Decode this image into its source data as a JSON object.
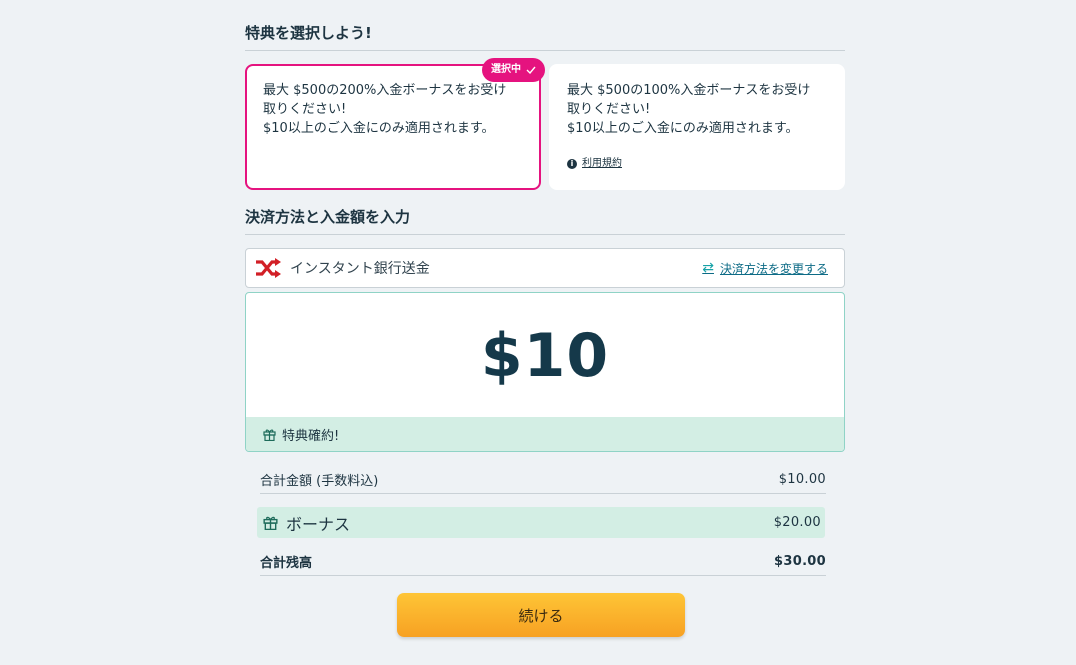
{
  "bonus_section": {
    "title": "特典を選択しよう!",
    "cards": [
      {
        "text": "最大 $500の200%入金ボーナスをお受け\n取りください!\n$10以上のご入金にのみ適用されます。",
        "selected": true,
        "badge": "選択中"
      },
      {
        "text": "最大 $500の100%入金ボーナスをお受け\n取りください!\n$10以上のご入金にのみ適用されます。",
        "selected": false,
        "terms_link": "利用規約"
      }
    ]
  },
  "payment_section": {
    "title": "決済方法と入金額を入力",
    "method_name": "インスタント銀行送金",
    "change_link": "決済方法を変更する",
    "amount": "$10",
    "bonus_confirmed": "特典確約!"
  },
  "summary": {
    "total_label": "合計金額 (手数料込)",
    "total_value": "$10.00",
    "bonus_label": "ボーナス",
    "bonus_value": "$20.00",
    "balance_label": "合計残高",
    "balance_value": "$30.00"
  },
  "continue_label": "続ける",
  "colors": {
    "selected_border": "#e5137f",
    "accent_green": "#d3eee4",
    "button": "#fbb52d",
    "text_dark": "#1d3441"
  }
}
